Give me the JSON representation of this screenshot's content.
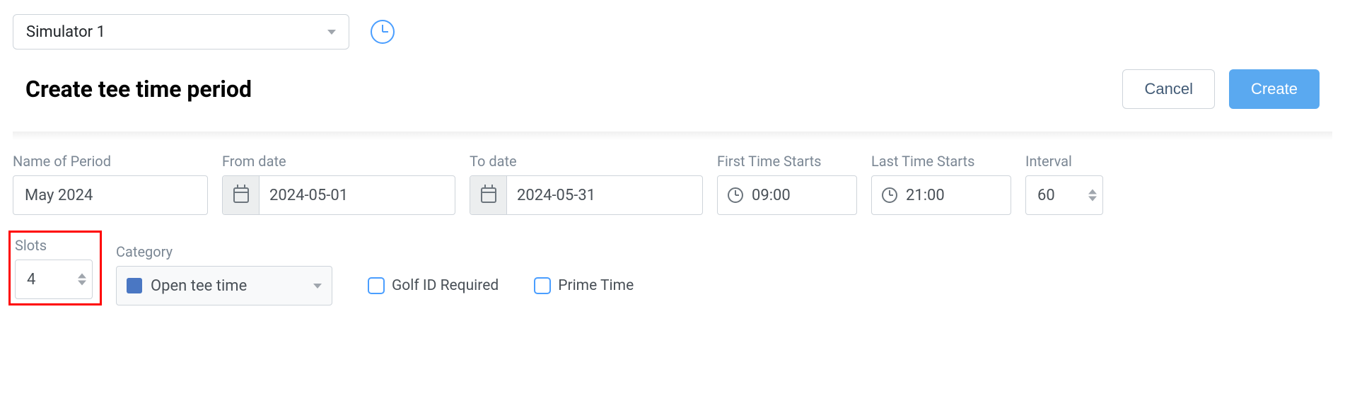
{
  "simulator": {
    "selected": "Simulator 1"
  },
  "page": {
    "title": "Create tee time period"
  },
  "actions": {
    "cancel": "Cancel",
    "create": "Create"
  },
  "labels": {
    "name": "Name of Period",
    "from": "From date",
    "to": "To date",
    "first": "First Time Starts",
    "last": "Last Time Starts",
    "interval": "Interval",
    "slots": "Slots",
    "category": "Category"
  },
  "values": {
    "name": "May 2024",
    "from": "2024-05-01",
    "to": "2024-05-31",
    "first": "09:00",
    "last": "21:00",
    "interval": "60",
    "slots": "4",
    "category": "Open tee time",
    "category_color": "#4a77c3"
  },
  "checkboxes": {
    "golf_id": "Golf ID Required",
    "prime_time": "Prime Time"
  }
}
